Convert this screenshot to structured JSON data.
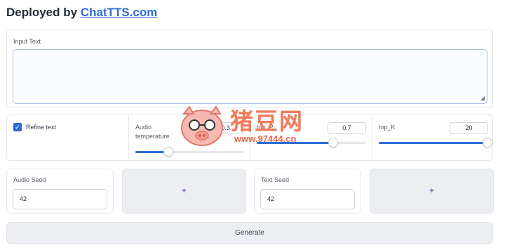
{
  "header": {
    "prefix": "Deployed by ",
    "link": "ChatTTS.com"
  },
  "input": {
    "label": "Input Text",
    "value": ""
  },
  "params": {
    "refine_text": {
      "label": "Refine text",
      "checked": true,
      "check_glyph": "✓"
    },
    "audio_temperature": {
      "label": "Audio temperature",
      "value": "0.3",
      "fraction": 0.3
    },
    "top_p": {
      "label": "top_P",
      "value": "0.7",
      "fraction": 0.7
    },
    "top_k": {
      "label": "top_K",
      "value": "20",
      "fraction": 1.0
    }
  },
  "audio_seed": {
    "label": "Audio Seed",
    "value": "42"
  },
  "text_seed": {
    "label": "Text Seed",
    "value": "42"
  },
  "dice_icon": {
    "glyph": "✦",
    "name": "dice-icon"
  },
  "generate": {
    "label": "Generate"
  },
  "watermark": {
    "text": "猪豆网",
    "url": "www.97444.cn"
  },
  "colors": {
    "accent": "#2f6cd6",
    "watermark": "#f07a5a"
  }
}
